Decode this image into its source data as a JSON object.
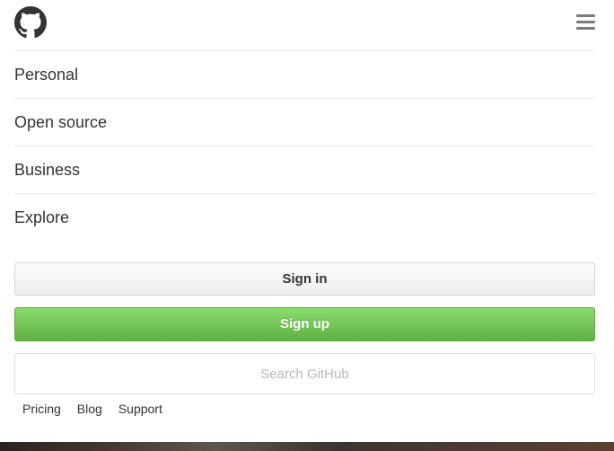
{
  "header": {
    "logo_icon": "github-octocat-icon",
    "menu_icon": "hamburger-menu-icon"
  },
  "nav": {
    "items": [
      {
        "label": "Personal"
      },
      {
        "label": "Open source"
      },
      {
        "label": "Business"
      },
      {
        "label": "Explore"
      }
    ]
  },
  "actions": {
    "signin_label": "Sign in",
    "signup_label": "Sign up"
  },
  "search": {
    "placeholder": "Search GitHub",
    "value": ""
  },
  "footer": {
    "links": [
      "Pricing",
      "Blog",
      "Support"
    ]
  },
  "colors": {
    "signup_green": "#60b044",
    "text": "#333333",
    "divider": "#e5e5e5"
  }
}
